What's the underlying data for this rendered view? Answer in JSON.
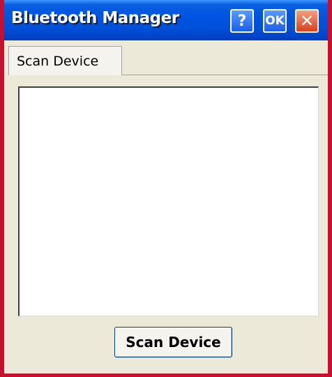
{
  "window": {
    "title": "Bluetooth Manager",
    "help_label": "?",
    "ok_label": "OK",
    "close_label": "✕"
  },
  "tabs": [
    {
      "label": "Scan Device",
      "selected": true
    }
  ],
  "device_list": {
    "items": []
  },
  "actions": {
    "scan_label": "Scan Device"
  },
  "colors": {
    "border_accent": "#c8102e",
    "titlebar": "#0054e3",
    "window_background": "#ece9d8"
  }
}
